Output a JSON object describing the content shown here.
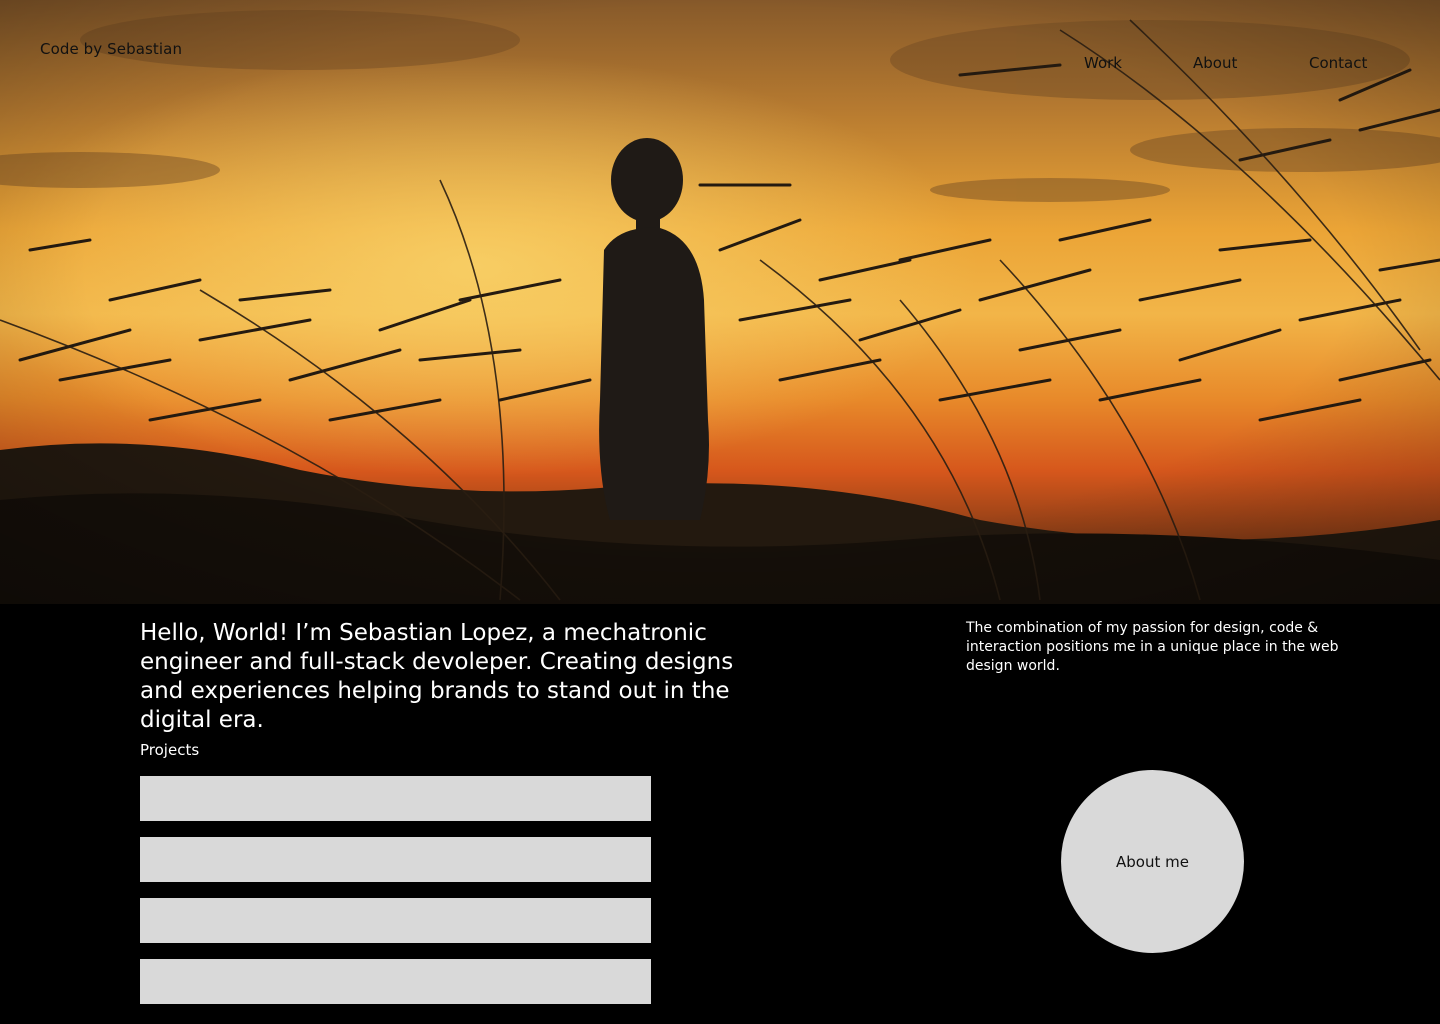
{
  "header": {
    "brand": "Code by Sebastian",
    "nav": [
      "Work",
      "About",
      "Contact"
    ]
  },
  "hero": {
    "image_description_icon": "sunset-silhouette-photo",
    "colors": {
      "sky_top": "#8a5a26",
      "sky_mid": "#e8962c",
      "sky_glow": "#f6c24a",
      "horizon": "#d9541c",
      "ground": "#1e1710"
    }
  },
  "intro": {
    "text": "Hello, World! I’m Sebastian Lopez, a mechatronic engineer and full-stack devoleper. Creating designs and experiences helping brands to stand out in the digital era."
  },
  "projects": {
    "label": "Projects",
    "items": [
      "",
      "",
      "",
      ""
    ]
  },
  "side": {
    "text": "The combination of my passion for design, code & interaction positions me in a unique place in the web design world."
  },
  "about_button": {
    "label": "About me"
  }
}
